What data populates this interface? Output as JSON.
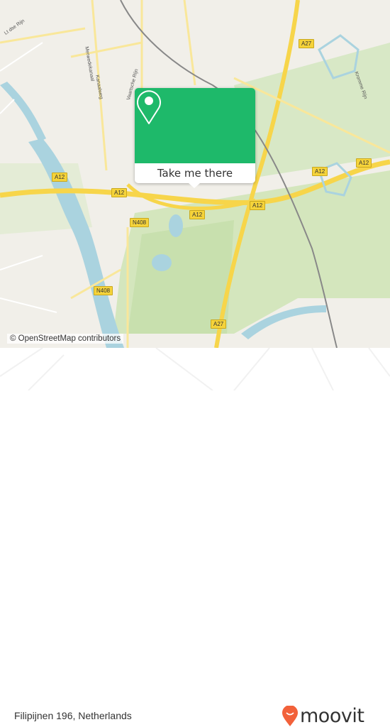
{
  "map": {
    "road_shields": [
      "A27",
      "A12",
      "A12",
      "A12",
      "A12",
      "A12",
      "A12",
      "N408",
      "N408",
      "A27"
    ],
    "road_labels": [
      "Kromme Rijn",
      "Vaartsche Rijn",
      "Merwedekanaal",
      "Kanaalweg",
      "Lt dse Rijn"
    ],
    "attribution": "© OpenStreetMap contributors"
  },
  "popup": {
    "icon": "map-pin-icon",
    "button_label": "Take me there",
    "color": "#1eb96a"
  },
  "footer": {
    "address": "Filipijnen 196, Netherlands",
    "logo_text": "moovit",
    "logo_color": "#f2613a"
  }
}
